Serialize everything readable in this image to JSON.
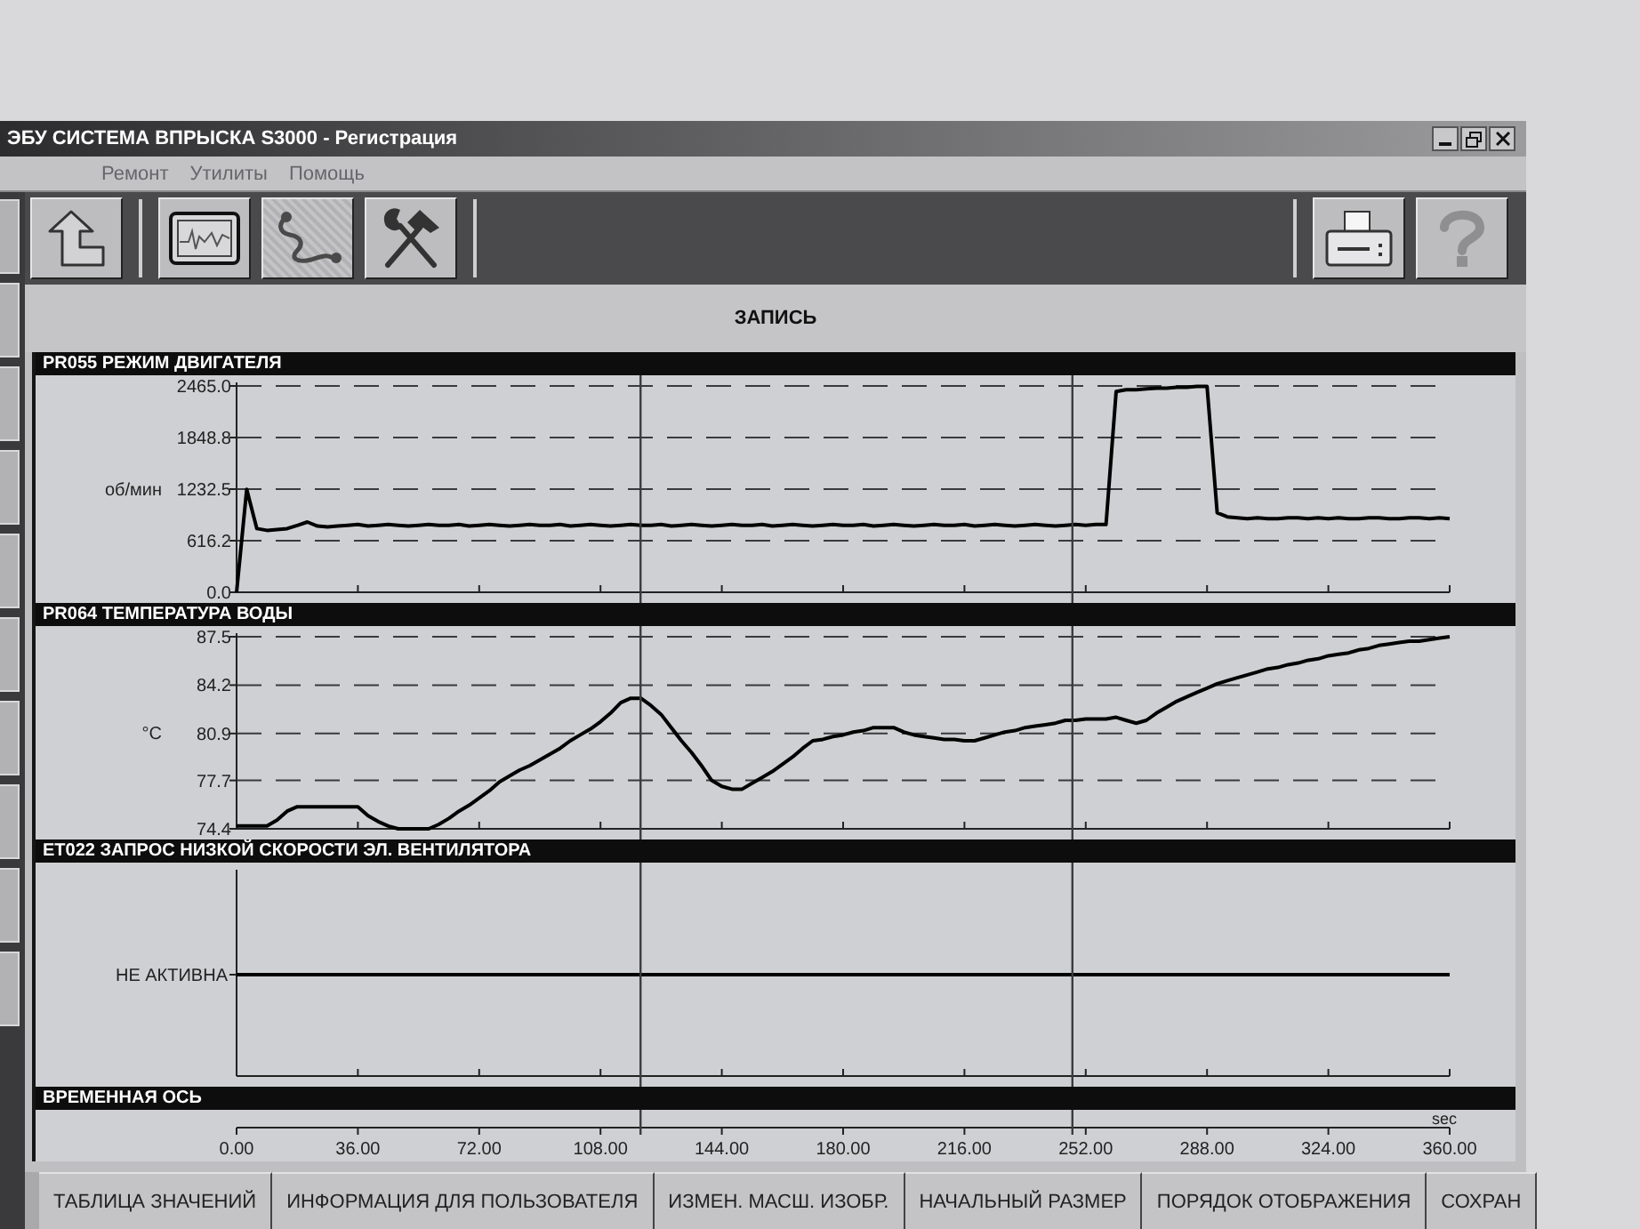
{
  "window": {
    "title": "ЭБУ СИСТЕМА ВПРЫСКА S3000 - Регистрация"
  },
  "menu": [
    {
      "label": "Ремонт",
      "disabled": true
    },
    {
      "label": "Утилиты",
      "disabled": true
    },
    {
      "label": "Помощь",
      "disabled": true
    }
  ],
  "section": {
    "title": "ЗАПИСЬ"
  },
  "charts": [
    {
      "chart_data": {
        "type": "line",
        "title": "PR055 РЕЖИМ ДВИГАТЕЛЯ",
        "ylabel": "об/мин",
        "grid": true,
        "categories": [
          null,
          null,
          null,
          null,
          null,
          null,
          null,
          null,
          null,
          null,
          null,
          null,
          null,
          null,
          null,
          null,
          null,
          null,
          null,
          null,
          null,
          null,
          null,
          null,
          null,
          null,
          null,
          null,
          null,
          null,
          null,
          null,
          null,
          null,
          null,
          null,
          null,
          null,
          null,
          null,
          null,
          null,
          null,
          null,
          null,
          null,
          null,
          null,
          null,
          null,
          null,
          null,
          null,
          null,
          null,
          null,
          null,
          null,
          null,
          null,
          null,
          null,
          null,
          null,
          null,
          null,
          null,
          null,
          null,
          null,
          null,
          null,
          null,
          null,
          null,
          null,
          null,
          null,
          null,
          null,
          null,
          null,
          null,
          null,
          null,
          null,
          null,
          null,
          null,
          null,
          null,
          null,
          null,
          null,
          null,
          null,
          null,
          null,
          null,
          null,
          null,
          null,
          null,
          null,
          null,
          null,
          null,
          null,
          null,
          null,
          null,
          null,
          null,
          null,
          null,
          null,
          null,
          null,
          null,
          null,
          null
        ],
        "series": [
          {
            "color": "#000000",
            "values": [
              0,
              1230,
              760,
              740,
              750,
              760,
              800,
              840,
              790,
              780,
              790,
              800,
              810,
              790,
              800,
              810,
              800,
              790,
              800,
              810,
              800,
              800,
              810,
              790,
              800,
              810,
              800,
              790,
              800,
              810,
              800,
              800,
              810,
              790,
              800,
              810,
              800,
              790,
              800,
              810,
              800,
              800,
              810,
              790,
              800,
              810,
              800,
              790,
              800,
              810,
              800,
              800,
              810,
              790,
              800,
              810,
              800,
              790,
              800,
              810,
              800,
              800,
              810,
              790,
              800,
              810,
              800,
              790,
              800,
              810,
              800,
              800,
              810,
              790,
              800,
              810,
              800,
              790,
              800,
              810,
              800,
              790,
              800,
              810,
              800,
              810,
              810,
              2400,
              2420,
              2420,
              2430,
              2440,
              2440,
              2450,
              2450,
              2460,
              2460,
              950,
              900,
              890,
              880,
              890,
              880,
              880,
              890,
              890,
              880,
              890,
              880,
              890,
              880,
              880,
              890,
              890,
              880,
              880,
              890,
              890,
              880,
              890,
              880
            ]
          }
        ],
        "ylim": [
          0,
          2465
        ],
        "yticks": [
          {
            "value": 0,
            "label": "0.0"
          },
          {
            "value": 616.2,
            "label": "616.2"
          },
          {
            "value": 1232.5,
            "label": "1232.5"
          },
          {
            "value": 1848.8,
            "label": "1848.8"
          },
          {
            "value": 2465,
            "label": "2465.0"
          }
        ]
      }
    },
    {
      "chart_data": {
        "type": "line",
        "title": "PR064 ТЕМПЕРАТУРА ВОДЫ",
        "ylabel": "°C",
        "grid": true,
        "categories": [
          null,
          null,
          null,
          null,
          null,
          null,
          null,
          null,
          null,
          null,
          null,
          null,
          null,
          null,
          null,
          null,
          null,
          null,
          null,
          null,
          null,
          null,
          null,
          null,
          null,
          null,
          null,
          null,
          null,
          null,
          null,
          null,
          null,
          null,
          null,
          null,
          null,
          null,
          null,
          null,
          null,
          null,
          null,
          null,
          null,
          null,
          null,
          null,
          null,
          null,
          null,
          null,
          null,
          null,
          null,
          null,
          null,
          null,
          null,
          null,
          null,
          null,
          null,
          null,
          null,
          null,
          null,
          null,
          null,
          null,
          null,
          null,
          null,
          null,
          null,
          null,
          null,
          null,
          null,
          null,
          null,
          null,
          null,
          null,
          null,
          null,
          null,
          null,
          null,
          null,
          null,
          null,
          null,
          null,
          null,
          null,
          null,
          null,
          null,
          null,
          null,
          null,
          null,
          null,
          null,
          null,
          null,
          null,
          null,
          null,
          null,
          null,
          null,
          null,
          null,
          null,
          null,
          null,
          null,
          null,
          null
        ],
        "series": [
          {
            "color": "#000000",
            "values": [
              74.6,
              74.6,
              74.6,
              74.6,
              75.0,
              75.6,
              75.9,
              75.9,
              75.9,
              75.9,
              75.9,
              75.9,
              75.9,
              75.3,
              74.9,
              74.6,
              74.4,
              74.4,
              74.4,
              74.4,
              74.7,
              75.1,
              75.6,
              76.0,
              76.5,
              77.0,
              77.6,
              78.0,
              78.4,
              78.7,
              79.1,
              79.5,
              79.9,
              80.4,
              80.8,
              81.2,
              81.7,
              82.3,
              83.0,
              83.3,
              83.3,
              82.8,
              82.2,
              81.3,
              80.4,
              79.6,
              78.7,
              77.7,
              77.3,
              77.1,
              77.1,
              77.5,
              77.9,
              78.3,
              78.8,
              79.3,
              79.9,
              80.4,
              80.5,
              80.7,
              80.8,
              81.0,
              81.1,
              81.3,
              81.3,
              81.3,
              81.0,
              80.8,
              80.7,
              80.6,
              80.5,
              80.5,
              80.4,
              80.4,
              80.6,
              80.8,
              81.0,
              81.1,
              81.3,
              81.4,
              81.5,
              81.6,
              81.8,
              81.8,
              81.9,
              81.9,
              81.9,
              82.0,
              81.8,
              81.6,
              81.8,
              82.3,
              82.7,
              83.1,
              83.4,
              83.7,
              84.0,
              84.3,
              84.5,
              84.7,
              84.9,
              85.1,
              85.3,
              85.4,
              85.6,
              85.7,
              85.9,
              86.0,
              86.2,
              86.3,
              86.4,
              86.6,
              86.7,
              86.9,
              87.0,
              87.1,
              87.2,
              87.2,
              87.3,
              87.4,
              87.5
            ]
          }
        ],
        "ylim": [
          74.4,
          87.5
        ],
        "yticks": [
          {
            "value": 74.4,
            "label": "74.4"
          },
          {
            "value": 77.7,
            "label": "77.7"
          },
          {
            "value": 80.9,
            "label": "80.9"
          },
          {
            "value": 84.2,
            "label": "84.2"
          },
          {
            "value": 87.5,
            "label": "87.5"
          }
        ]
      }
    }
  ],
  "state_chart": {
    "title": "ET022  ЗАПРОС НИЗКОЙ СКОРОСТИ ЭЛ. ВЕНТИЛЯТОРА",
    "state": "НЕ АКТИВНА"
  },
  "time_axis": {
    "title": "ВРЕМЕННАЯ ОСЬ",
    "unit": "sec",
    "ticks": [
      "0.00",
      "36.00",
      "72.00",
      "108.00",
      "144.00",
      "180.00",
      "216.00",
      "252.00",
      "288.00",
      "324.00",
      "360.00"
    ],
    "cursors": [
      {
        "level": 0.333
      },
      {
        "level": 0.689
      }
    ]
  },
  "buttons": [
    "ТАБЛИЦА ЗНАЧЕНИЙ",
    "ИНФОРМАЦИЯ ДЛЯ ПОЛЬЗОВАТЕЛЯ",
    "ИЗМЕН. МАСШ. ИЗОБР.",
    "НАЧАЛЬНЫЙ РАЗМЕР",
    "ПОРЯДОК ОТОБРАЖЕНИЯ",
    "СОХРАН"
  ]
}
